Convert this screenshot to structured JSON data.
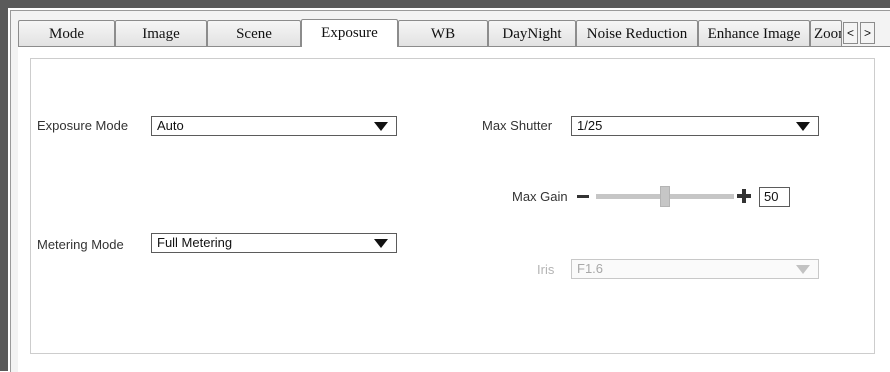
{
  "tabs": {
    "items": [
      "Mode",
      "Image",
      "Scene",
      "Exposure",
      "WB",
      "DayNight",
      "Noise Reduction",
      "Enhance Image",
      "Zoom"
    ],
    "active": "Exposure",
    "nav_prev": "<",
    "nav_next": ">"
  },
  "exposure": {
    "exposure_mode": {
      "label": "Exposure Mode",
      "value": "Auto"
    },
    "metering_mode": {
      "label": "Metering Mode",
      "value": "Full Metering"
    },
    "max_shutter": {
      "label": "Max Shutter",
      "value": "1/25"
    },
    "max_gain": {
      "label": "Max Gain",
      "value": "50",
      "level_percent": 50
    },
    "iris": {
      "label": "Iris",
      "value": "F1.6",
      "disabled": true
    }
  },
  "icons": {
    "decrease": "minus-icon",
    "increase": "plus-icon",
    "dropdown": "triangle-down-icon"
  }
}
